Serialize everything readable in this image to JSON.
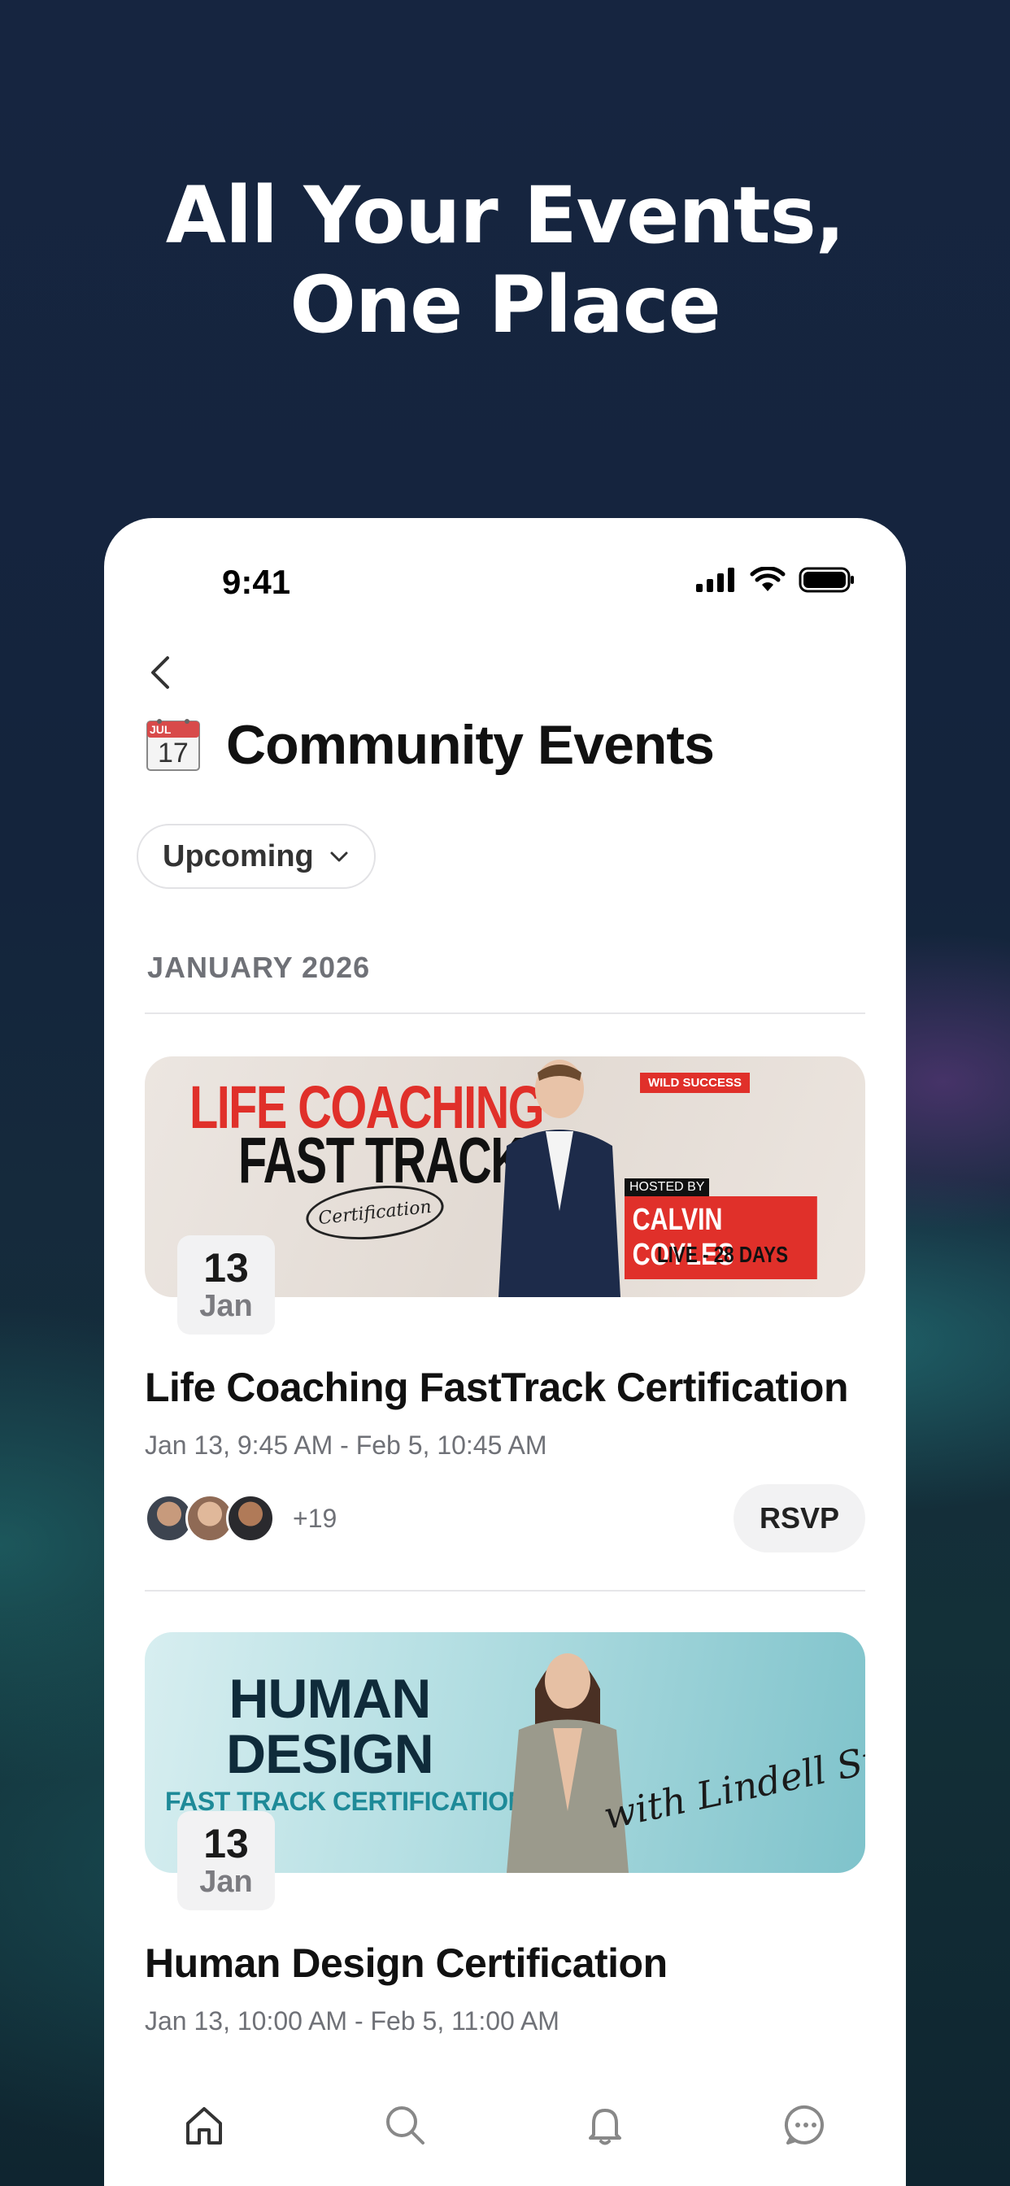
{
  "headline": {
    "line1": "All Your Events,",
    "line2": "One Place"
  },
  "status_bar": {
    "time": "9:41"
  },
  "page": {
    "title": "Community Events",
    "calendar_icon": {
      "month": "JUL",
      "day": "17"
    },
    "filter_label": "Upcoming",
    "section_label": "JANUARY 2026"
  },
  "events": [
    {
      "banner": {
        "line1": "LIFE COACHING",
        "line2": "FAST TRACK",
        "badge": "Certification",
        "tag": "WILD SUCCESS",
        "hosted_by": "HOSTED BY",
        "host": "CALVIN COYLES",
        "duration": "LIVE - 28 DAYS"
      },
      "date_day": "13",
      "date_month": "Jan",
      "title": "Life Coaching FastTrack Certification",
      "time": "Jan 13, 9:45 AM - Feb 5, 10:45 AM",
      "attendee_extra": "+19",
      "rsvp_label": "RSVP"
    },
    {
      "banner": {
        "line1": "HUMAN",
        "line2": "DESIGN",
        "subtitle": "FAST TRACK CERTIFICATION",
        "signature": "with Lindell Stewart"
      },
      "date_day": "13",
      "date_month": "Jan",
      "title": "Human Design Certification",
      "time": "Jan 13, 10:00 AM - Feb 5, 11:00 AM"
    }
  ],
  "tabbar": {
    "items": [
      "home-icon",
      "search-icon",
      "bell-icon",
      "chat-icon"
    ]
  },
  "colors": {
    "background": "#132239",
    "accent_red": "#e0302a",
    "teal": "#1e8a98"
  }
}
